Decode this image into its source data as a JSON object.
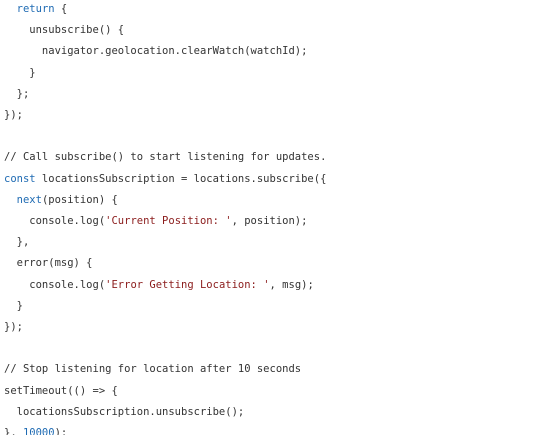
{
  "code": {
    "language": "javascript",
    "colors": {
      "keyword": "#1f6bb3",
      "number": "#1f6bb3",
      "string": "#8b1c1c",
      "plain": "#333333",
      "background": "#ffffff"
    },
    "lines": [
      [
        {
          "t": "  ",
          "k": "plain"
        },
        {
          "t": "return",
          "k": "kw"
        },
        {
          "t": " {",
          "k": "plain"
        }
      ],
      [
        {
          "t": "    unsubscribe() {",
          "k": "plain"
        }
      ],
      [
        {
          "t": "      navigator.geolocation.clearWatch(watchId);",
          "k": "plain"
        }
      ],
      [
        {
          "t": "    }",
          "k": "plain"
        }
      ],
      [
        {
          "t": "  };",
          "k": "plain"
        }
      ],
      [
        {
          "t": "});",
          "k": "plain"
        }
      ],
      [],
      [
        {
          "t": "// Call subscribe() to start listening for updates.",
          "k": "cm"
        }
      ],
      [
        {
          "t": "const",
          "k": "kw"
        },
        {
          "t": " locationsSubscription = locations.subscribe({",
          "k": "plain"
        }
      ],
      [
        {
          "t": "  ",
          "k": "plain"
        },
        {
          "t": "next",
          "k": "kw"
        },
        {
          "t": "(position) {",
          "k": "plain"
        }
      ],
      [
        {
          "t": "    console.log(",
          "k": "plain"
        },
        {
          "t": "'Current Position: '",
          "k": "str"
        },
        {
          "t": ", position);",
          "k": "plain"
        }
      ],
      [
        {
          "t": "  },",
          "k": "plain"
        }
      ],
      [
        {
          "t": "  error(msg) {",
          "k": "plain"
        }
      ],
      [
        {
          "t": "    console.log(",
          "k": "plain"
        },
        {
          "t": "'Error Getting Location: '",
          "k": "str"
        },
        {
          "t": ", msg);",
          "k": "plain"
        }
      ],
      [
        {
          "t": "  }",
          "k": "plain"
        }
      ],
      [
        {
          "t": "});",
          "k": "plain"
        }
      ],
      [],
      [
        {
          "t": "// Stop listening for location after 10 seconds",
          "k": "cm"
        }
      ],
      [
        {
          "t": "setTimeout(() => {",
          "k": "plain"
        }
      ],
      [
        {
          "t": "  locationsSubscription.unsubscribe();",
          "k": "plain"
        }
      ],
      [
        {
          "t": "}, ",
          "k": "plain"
        },
        {
          "t": "10000",
          "k": "num"
        },
        {
          "t": ");",
          "k": "plain"
        }
      ]
    ]
  }
}
